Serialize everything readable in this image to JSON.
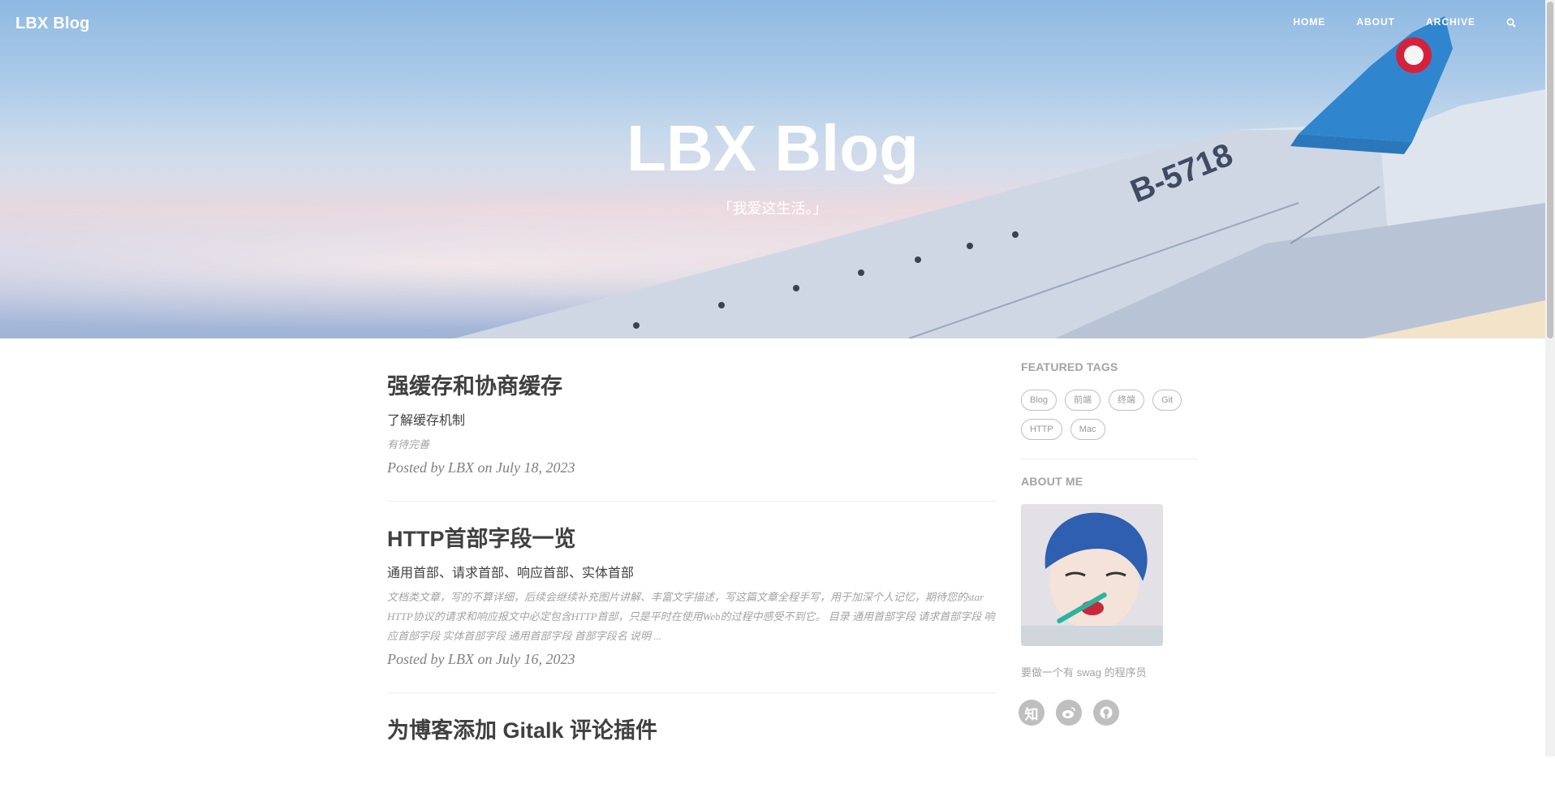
{
  "header": {
    "brand": "LBX Blog",
    "nav": [
      "HOME",
      "ABOUT",
      "ARCHIVE"
    ],
    "search_icon": "search-icon"
  },
  "hero": {
    "title": "LBX Blog",
    "subtitle": "「我爱这生活。」",
    "tail_text": "B-5718"
  },
  "posts": [
    {
      "title": "强缓存和协商缓存",
      "subtitle": "了解缓存机制",
      "excerpt": "有待完善",
      "meta": "Posted by LBX on July 18, 2023"
    },
    {
      "title": "HTTP首部字段一览",
      "subtitle": "通用首部、请求首部、响应首部、实体首部",
      "excerpt": "文档类文章，写的不算详细，后续会继续补充图片讲解、丰富文字描述，写这篇文章全程手写，用于加深个人记忆，期待您的star HTTP协议的请求和响应报文中必定包含HTTP首部，只是平时在使用Web的过程中感受不到它。 目录 通用首部字段 请求首部字段 响应首部字段 实体首部字段 通用首部字段 首部字段名 说明 ...",
      "meta": "Posted by LBX on July 16, 2023"
    },
    {
      "title": "为博客添加 Gitalk 评论插件",
      "subtitle": "",
      "excerpt": "",
      "meta": ""
    }
  ],
  "sidebar": {
    "featured_title": "FEATURED TAGS",
    "tags": [
      "Blog",
      "前端",
      "终端",
      "Git",
      "HTTP",
      "Mac"
    ],
    "about_title": "ABOUT ME",
    "about_text": "要做一个有 swag 的程序员",
    "socials": [
      {
        "icon": "zhihu-icon",
        "glyph": "知"
      },
      {
        "icon": "weibo-icon",
        "glyph": ""
      },
      {
        "icon": "github-icon",
        "glyph": ""
      }
    ]
  },
  "colors": {
    "text": "#404040",
    "muted": "#a3a3a3",
    "social_bg": "#bfbfbf",
    "sky_top": "#8fb9e2",
    "wing_blue": "#2f86cf",
    "wing_white": "#e9edf3"
  }
}
